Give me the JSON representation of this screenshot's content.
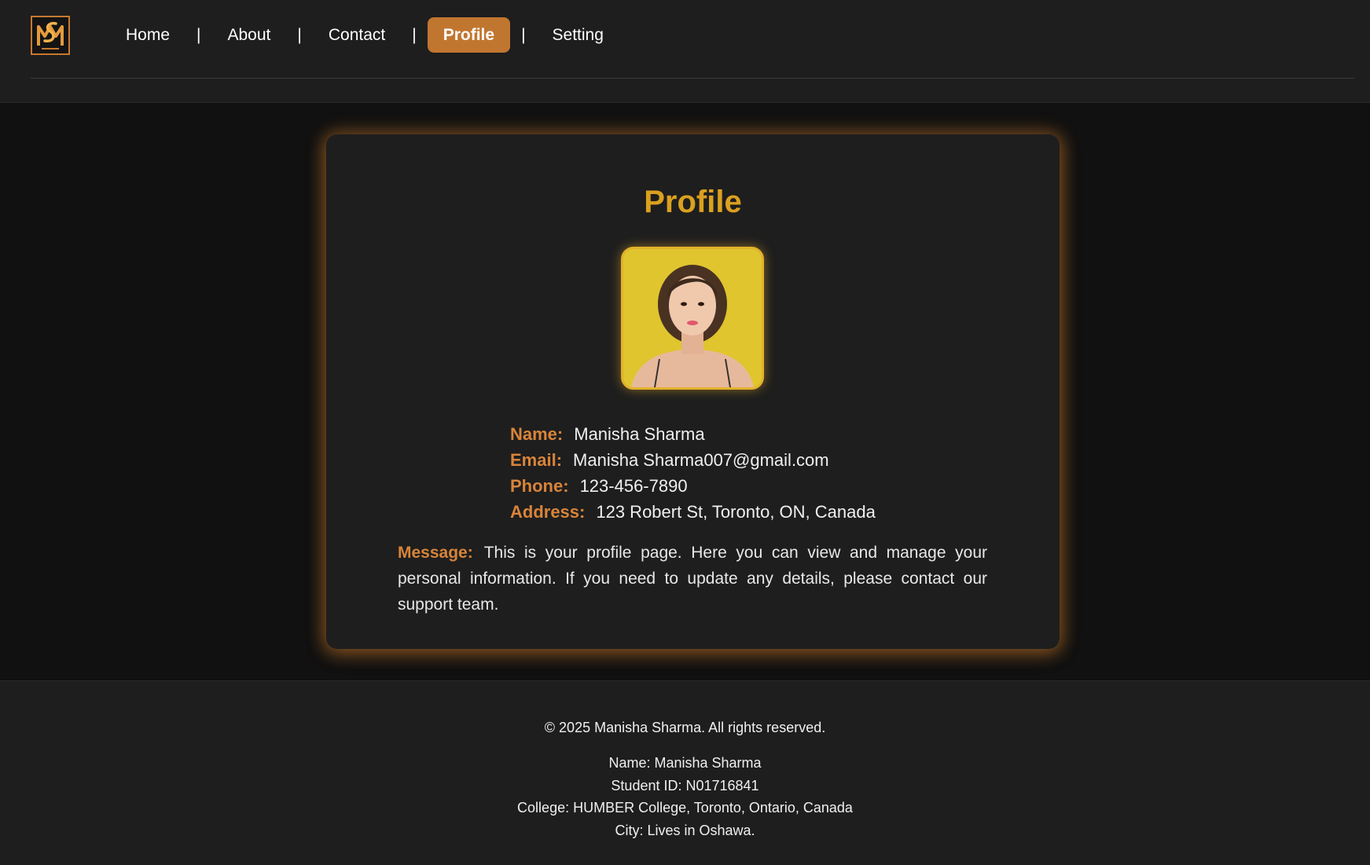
{
  "header": {
    "logo_icon": "ms-monogram-logo",
    "nav": [
      {
        "label": "Home",
        "active": false
      },
      {
        "label": "About",
        "active": false
      },
      {
        "label": "Contact",
        "active": false
      },
      {
        "label": "Profile",
        "active": true
      },
      {
        "label": "Setting",
        "active": false
      }
    ],
    "separator": "|"
  },
  "card": {
    "title": "Profile",
    "avatar_icon": "profile-photo",
    "fields": {
      "name": {
        "label": "Name:",
        "value": "Manisha Sharma"
      },
      "email": {
        "label": "Email:",
        "value": "Manisha Sharma007@gmail.com"
      },
      "phone": {
        "label": "Phone:",
        "value": "123-456-7890"
      },
      "address": {
        "label": "Address:",
        "value": "123 Robert St, Toronto, ON, Canada"
      }
    },
    "message": {
      "label": "Message:",
      "text": "This is your profile page. Here you can view and manage your personal information. If you need to update any details, please contact our support team."
    }
  },
  "footer": {
    "copyright": "© 2025 Manisha Sharma. All rights reserved.",
    "lines": [
      "Name: Manisha Sharma",
      "Student ID: N01716841",
      "College: HUMBER College, Toronto, Ontario, Canada",
      "City: Lives in Oshawa."
    ]
  },
  "colors": {
    "accent": "#c17630",
    "title": "#dba01f",
    "label": "#d8843a",
    "background": "#111111",
    "panel": "#1e1e1e"
  }
}
